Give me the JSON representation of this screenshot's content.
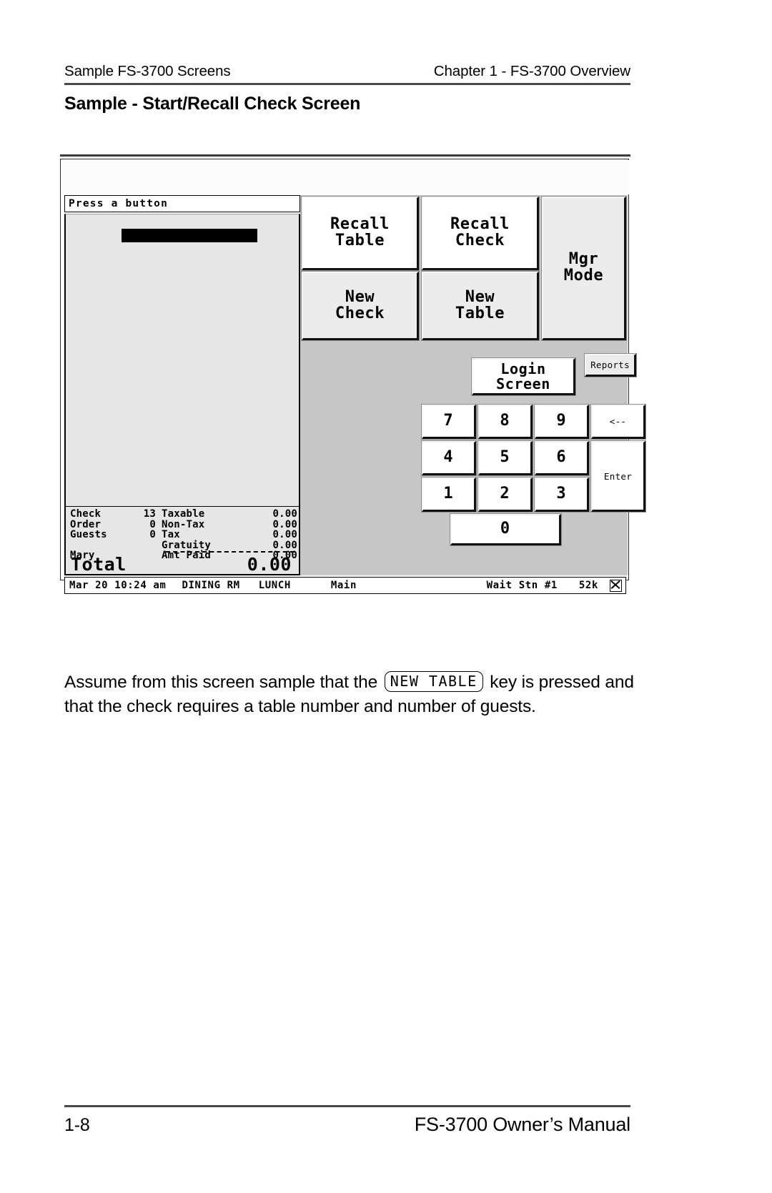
{
  "running_head": {
    "left": "Sample FS-3700 Screens",
    "right": "Chapter 1 - FS-3700 Overview"
  },
  "section_title": "Sample - Start/Recall Check Screen",
  "pos_screen": {
    "prompt": "Press a button",
    "check_panel": {
      "rows": [
        {
          "label": "Check",
          "count": "13",
          "name": "Taxable",
          "amount": "0.00"
        },
        {
          "label": "Order",
          "count": "0",
          "name": "Non-Tax",
          "amount": "0.00"
        },
        {
          "label": "Guests",
          "count": "0",
          "name": "Tax",
          "amount": "0.00"
        },
        {
          "label": "",
          "count": "",
          "name": "Gratuity",
          "amount": "0.00"
        },
        {
          "label": "Mary",
          "count": "",
          "name": "Amt Paid",
          "amount": "0.00"
        }
      ],
      "total_label": "Total",
      "total_amount": "0.00"
    },
    "function_keys": [
      {
        "id": "recall-table",
        "label": "Recall\nTable",
        "style": "white"
      },
      {
        "id": "recall-check",
        "label": "Recall\nCheck",
        "style": "white"
      },
      {
        "id": "new-check",
        "label": "New\nCheck",
        "style": "grey"
      },
      {
        "id": "new-table",
        "label": "New\nTable",
        "style": "grey"
      },
      {
        "id": "mgr-mode",
        "label": "Mgr\nMode",
        "style": "grey"
      }
    ],
    "login_key": "Login\nScreen",
    "reports_key": "Reports",
    "keypad": {
      "keys": [
        "7",
        "8",
        "9",
        "4",
        "5",
        "6",
        "1",
        "2",
        "3",
        "0"
      ],
      "backspace": "<--",
      "enter": "Enter"
    },
    "status_bar": {
      "date_time": "Mar 20 10:24 am",
      "room": "DINING RM",
      "meal_period": "LUNCH",
      "menu": "Main",
      "station": "Wait Stn #1",
      "memory": "52k",
      "icon": "x-box-icon"
    }
  },
  "body_text": {
    "before": "Assume from this screen sample that the",
    "keycap": "NEW TABLE",
    "after": "key is pressed and that the check requires a table number and number of guests."
  },
  "footer": {
    "page_number": "1-8",
    "manual_title": "FS-3700 Owner’s Manual"
  }
}
